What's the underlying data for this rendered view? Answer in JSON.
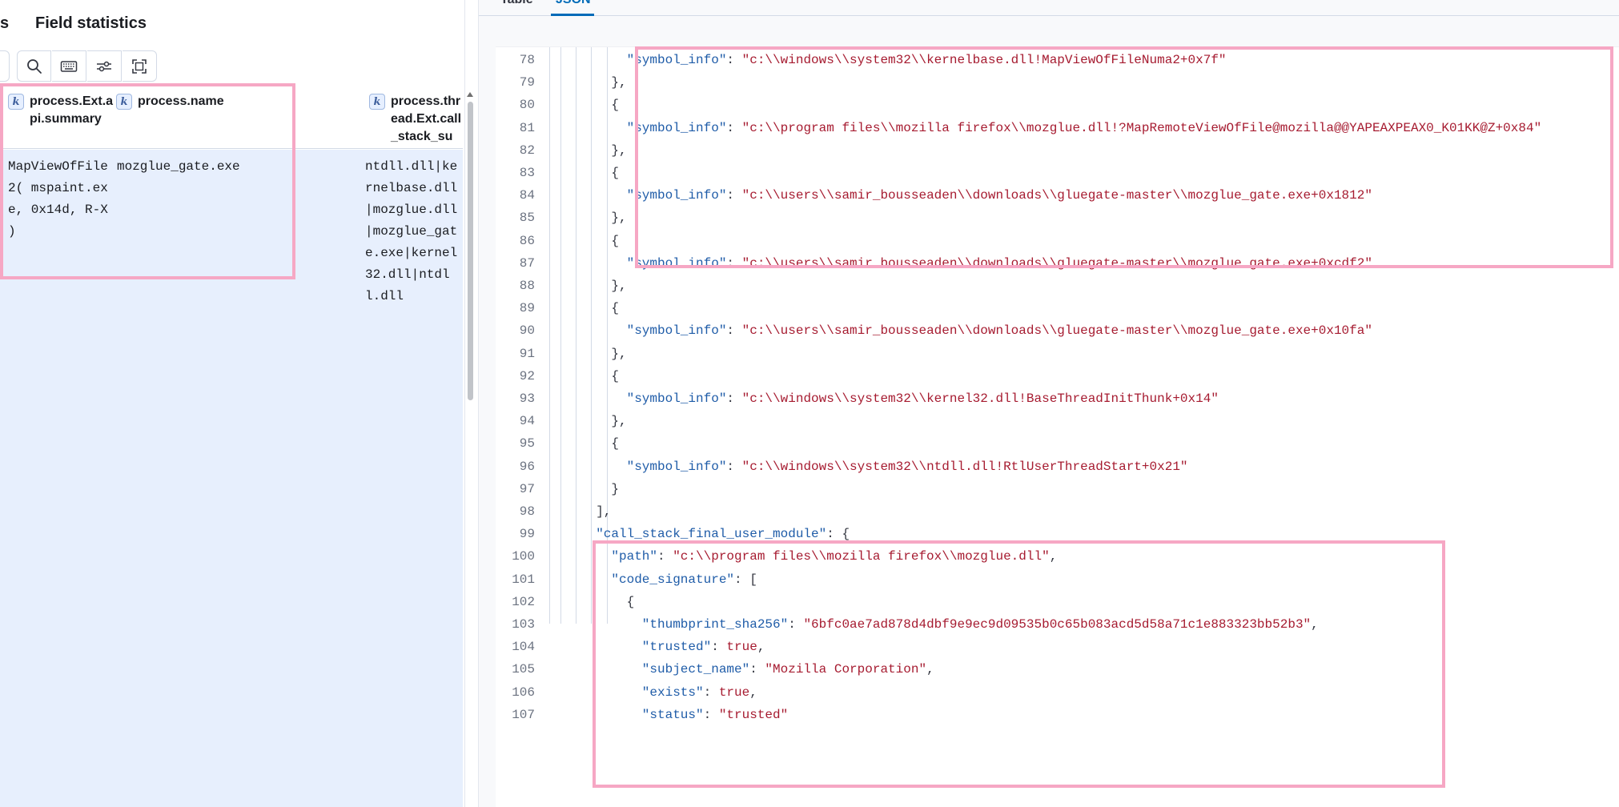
{
  "left_panel": {
    "tabs": {
      "cut_label": "s",
      "field_statistics_label": "Field statistics"
    },
    "toolbar": {
      "search_icon": "search-icon",
      "keyboard_icon": "keyboard-icon",
      "settings_icon": "sliders-icon",
      "fullscreen_icon": "fullscreen-icon"
    },
    "columns": [
      {
        "type_badge": "k",
        "title": "process.Ext.api.summary"
      },
      {
        "type_badge": "k",
        "title": "process.name"
      },
      {
        "type_badge": "k",
        "title": "process.thread.Ext.call_stack_summary"
      }
    ],
    "row": {
      "api_summary": "MapViewOfFile2( mspaint.exe, 0x14d, R-X )",
      "process_name": "mozglue_gate.exe",
      "call_stack_summary": "ntdll.dll|kernelbase.dll|mozglue.dll|mozglue_gate.exe|kernel32.dll|ntdll.dll"
    }
  },
  "right_panel": {
    "tabs": {
      "table_label": "Table",
      "json_label": "JSON"
    },
    "code_lines": [
      {
        "n": "78",
        "t": "      \"symbol_info\": \"c:\\\\windows\\\\system32\\\\kernelbase.dll!MapViewOfFileNuma2+0x7f\""
      },
      {
        "n": "79",
        "t": "    },"
      },
      {
        "n": "80",
        "t": "    {"
      },
      {
        "n": "81",
        "t": "      \"symbol_info\": \"c:\\\\program files\\\\mozilla firefox\\\\mozglue.dll!?MapRemoteViewOfFile@mozilla@@YAPEAXPEAX0_K01KK@Z+0x84\""
      },
      {
        "n": "82",
        "t": "    },"
      },
      {
        "n": "83",
        "t": "    {"
      },
      {
        "n": "84",
        "t": "      \"symbol_info\": \"c:\\\\users\\\\samir_bousseaden\\\\downloads\\\\gluegate-master\\\\mozglue_gate.exe+0x1812\""
      },
      {
        "n": "85",
        "t": "    },"
      },
      {
        "n": "86",
        "t": "    {"
      },
      {
        "n": "87",
        "t": "      \"symbol_info\": \"c:\\\\users\\\\samir_bousseaden\\\\downloads\\\\gluegate-master\\\\mozglue_gate.exe+0xcdf2\""
      },
      {
        "n": "88",
        "t": "    },"
      },
      {
        "n": "89",
        "t": "    {"
      },
      {
        "n": "90",
        "t": "      \"symbol_info\": \"c:\\\\users\\\\samir_bousseaden\\\\downloads\\\\gluegate-master\\\\mozglue_gate.exe+0x10fa\""
      },
      {
        "n": "91",
        "t": "    },"
      },
      {
        "n": "92",
        "t": "    {"
      },
      {
        "n": "93",
        "t": "      \"symbol_info\": \"c:\\\\windows\\\\system32\\\\kernel32.dll!BaseThreadInitThunk+0x14\""
      },
      {
        "n": "94",
        "t": "    },"
      },
      {
        "n": "95",
        "t": "    {"
      },
      {
        "n": "96",
        "t": "      \"symbol_info\": \"c:\\\\windows\\\\system32\\\\ntdll.dll!RtlUserThreadStart+0x21\""
      },
      {
        "n": "97",
        "t": "    }"
      },
      {
        "n": "98",
        "t": "  ],"
      },
      {
        "n": "99",
        "t": "  \"call_stack_final_user_module\": {"
      },
      {
        "n": "100",
        "t": "    \"path\": \"c:\\\\program files\\\\mozilla firefox\\\\mozglue.dll\","
      },
      {
        "n": "101",
        "t": "    \"code_signature\": ["
      },
      {
        "n": "102",
        "t": "      {"
      },
      {
        "n": "103",
        "t": "        \"thumbprint_sha256\": \"6bfc0ae7ad878d4dbf9e9ec9d09535b0c65b083acd5d58a71c1e883323bb52b3\","
      },
      {
        "n": "104",
        "t": "        \"trusted\": true,"
      },
      {
        "n": "105",
        "t": "        \"subject_name\": \"Mozilla Corporation\","
      },
      {
        "n": "106",
        "t": "        \"exists\": true,"
      },
      {
        "n": "107",
        "t": "        \"status\": \"trusted\""
      }
    ]
  },
  "colors": {
    "highlight": "#f6a7c4",
    "json_key": "#1f5ca8",
    "json_string": "#a61b30",
    "selected_row": "#e7effd",
    "accent": "#006bb8"
  }
}
